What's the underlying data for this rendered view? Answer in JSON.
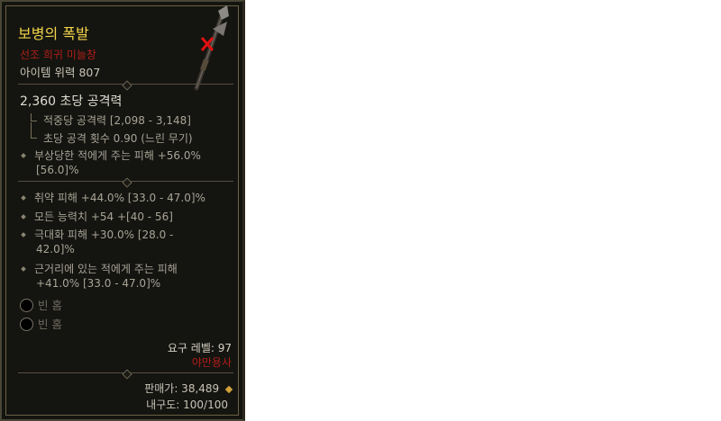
{
  "item": {
    "name": "보병의 폭발",
    "subtype": "선조 희귀 미늘창",
    "power": "아이템 위력 807",
    "dps": "2,360 초당 공격력",
    "damage_per_hit": "적중당 공격력 [2,098 - 3,148]",
    "attack_speed": "초당 공격 횟수 0.90 (느린 무기)",
    "implicit": {
      "line1": "부상당한 적에게 주는 피해 +56.0%",
      "line2": "[56.0]%"
    },
    "affixes": [
      {
        "line1": "취약 피해 +44.0% [33.0 - 47.0]%"
      },
      {
        "line1": "모든 능력치 +54 +[40 - 56]"
      },
      {
        "line1": "극대화 피해 +30.0% [28.0 -",
        "line2": "42.0]%"
      },
      {
        "line1": "근거리에 있는 적에게 주는 피해",
        "line2": "+41.0% [33.0 - 47.0]%"
      }
    ],
    "sockets": [
      "빈 홈",
      "빈 홈"
    ],
    "required_level": "요구 레벨: 97",
    "class_req": "야만용사",
    "sell_value": "판매가: 38,489",
    "durability": "내구도: 100/100"
  },
  "colors": {
    "name": "#f2d44a",
    "rarity": "#b01e18",
    "class_req": "#b01e18",
    "text": "#a8a496"
  },
  "icons": {
    "weapon": "halberd-icon",
    "unusable": "red-x-icon",
    "gold": "gold-coin-icon",
    "socket": "empty-socket-icon"
  }
}
